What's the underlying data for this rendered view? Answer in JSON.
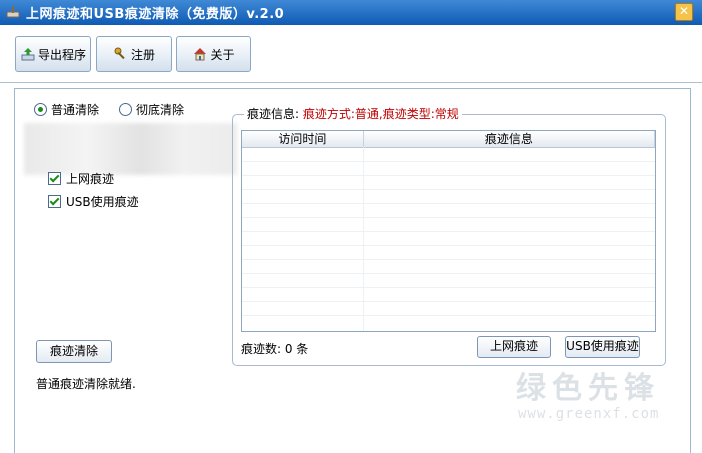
{
  "window": {
    "title": "上网痕迹和USB痕迹清除（免费版）v.2.0",
    "close_glyph": "✕",
    "accent": "#0f5bb4",
    "icon": "broom-icon"
  },
  "toolbar": [
    {
      "label": "导出程序",
      "icon": "export-icon"
    },
    {
      "label": "注册",
      "icon": "register-key-icon"
    },
    {
      "label": "关于",
      "icon": "about-house-icon"
    }
  ],
  "mode": {
    "options": [
      {
        "label": "普通清除",
        "checked": true
      },
      {
        "label": "彻底清除",
        "checked": false
      }
    ]
  },
  "checks": [
    {
      "label": "上网痕迹",
      "checked": true
    },
    {
      "label": "USB使用痕迹",
      "checked": true
    }
  ],
  "actions": {
    "clear_label": "痕迹清除"
  },
  "status": {
    "text": "普通痕迹清除就绪."
  },
  "info_group": {
    "legend_prefix": "痕迹信息:",
    "legend_detail": "痕迹方式:普通,痕迹类型:常规",
    "columns": [
      "访问时间",
      "痕迹信息"
    ],
    "rows": [],
    "count_label": "痕迹数: 0 条",
    "buttons": [
      "上网痕迹",
      "USB使用痕迹"
    ]
  },
  "watermark": {
    "text": "绿色先锋",
    "url": "www.greenxf.com"
  }
}
